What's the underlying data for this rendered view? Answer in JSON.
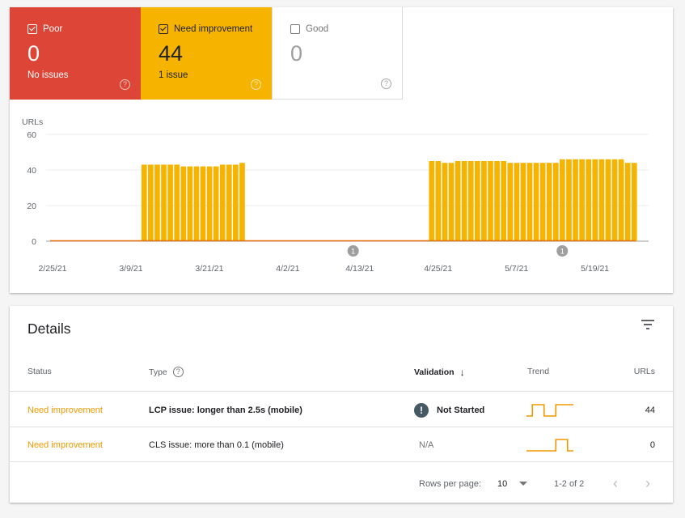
{
  "tiles": [
    {
      "label": "Poor",
      "checked": true,
      "value": "0",
      "sub": "No issues",
      "color": "#dd4537"
    },
    {
      "label": "Need improvement",
      "checked": true,
      "value": "44",
      "sub": "1 issue",
      "color": "#f6b400"
    },
    {
      "label": "Good",
      "checked": false,
      "value": "0",
      "sub": "",
      "color": "#ffffff"
    }
  ],
  "help_glyph": "?",
  "chart_data": {
    "type": "bar",
    "ylabel": "URLs",
    "ylim": [
      0,
      60
    ],
    "yticks": [
      0,
      20,
      40,
      60
    ],
    "xtick_labels": [
      "2/25/21",
      "3/9/21",
      "3/21/21",
      "4/2/21",
      "4/13/21",
      "4/25/21",
      "5/7/21",
      "5/19/21"
    ],
    "xtick_day_index": [
      0,
      12,
      24,
      36,
      47,
      59,
      71,
      83
    ],
    "start_date": "2/25/21",
    "num_days": 90,
    "grid": true,
    "series": [
      {
        "name": "Need improvement",
        "color": "#f6b400",
        "segments": [
          {
            "start_day": 14,
            "values": [
              43,
              43,
              43,
              43,
              43,
              43,
              42,
              42,
              42,
              42,
              42,
              42,
              43,
              43,
              43,
              44
            ]
          },
          {
            "start_day": 58,
            "values": [
              45,
              45,
              44,
              44,
              45,
              45,
              45,
              45,
              45,
              45,
              45,
              45,
              44,
              44,
              44,
              44,
              44,
              44,
              44,
              44,
              46,
              46,
              46,
              46,
              46,
              46,
              46,
              46,
              46,
              46,
              44,
              44
            ]
          }
        ]
      },
      {
        "name": "Poor",
        "color": "#e8710a",
        "constant": 0
      }
    ],
    "annotations": [
      {
        "day_index": 46,
        "label": "1"
      },
      {
        "day_index": 78,
        "label": "1"
      }
    ]
  },
  "details": {
    "title": "Details",
    "columns": {
      "status": "Status",
      "type": "Type",
      "validation": "Validation",
      "trend": "Trend",
      "urls": "URLs"
    },
    "sort_arrow": "↓",
    "rows": [
      {
        "status": "Need improvement",
        "type": "LCP issue: longer than 2.5s (mobile)",
        "validation": "Not Started",
        "validation_icon": "!",
        "trend": [
          0,
          1,
          1,
          0,
          0,
          1,
          1,
          1
        ],
        "urls": "44"
      },
      {
        "status": "Need improvement",
        "type": "CLS issue: more than 0.1 (mobile)",
        "validation": "N/A",
        "trend": [
          0,
          0,
          0,
          0,
          0,
          1,
          1,
          0
        ],
        "urls": "0"
      }
    ],
    "footer": {
      "rows_per_page_label": "Rows per page:",
      "rows_per_page": "10",
      "range": "1-2 of 2",
      "prev": "‹",
      "next": "›"
    }
  },
  "colors": {
    "poor": "#dd4537",
    "need_improvement": "#f6b400",
    "status_text": "#f29900",
    "trend_line": "#f29900"
  }
}
